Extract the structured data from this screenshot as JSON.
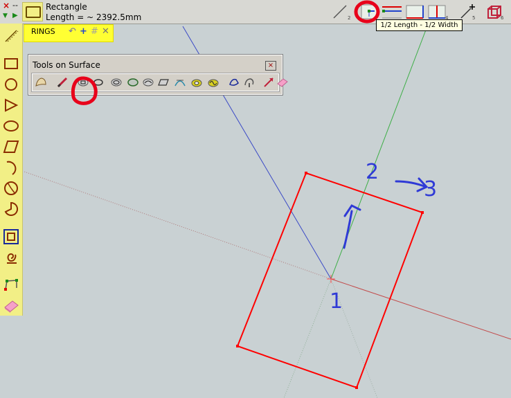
{
  "header": {
    "close_symbol": "×",
    "dashes": "--",
    "tool_name": "Rectangle",
    "length_text": "Length = ~ 2392.5mm"
  },
  "rings": {
    "label": "RINGS",
    "icons": [
      "undo-icon",
      "add-icon",
      "grid-icon",
      "close-icon"
    ]
  },
  "palette": {
    "title": "Tools on Surface",
    "close_symbol": "×"
  },
  "tooltip": {
    "text": "1/2 Length - 1/2 Width"
  },
  "toolbar_numbers": [
    "2",
    "3",
    "4",
    "5",
    "6"
  ],
  "annotations": {
    "num1": "1",
    "num2": "2",
    "num3": "3"
  },
  "colors": {
    "toolbar_bg": "#d8d8d3",
    "sidebar_bg": "#f2ef86",
    "rings_bg": "#ffff33",
    "canvas_bg": "#c9d1d3",
    "rectangle": "#ff0000",
    "annotation": "#2f3ad6",
    "highlight_circle": "#e8001a"
  }
}
